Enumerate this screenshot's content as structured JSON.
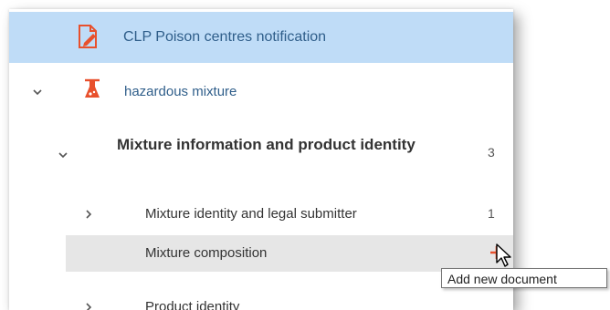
{
  "tree": {
    "notification": {
      "label": "CLP Poison centres notification",
      "icon": "document-edit-icon"
    },
    "mixture": {
      "label": "hazardous mixture",
      "icon": "flask-icon"
    },
    "info_section": {
      "title": "Mixture information and product identity",
      "count": "3"
    },
    "identity": {
      "label": "Mixture identity and legal submitter",
      "count": "1"
    },
    "composition": {
      "label": "Mixture composition",
      "action_icon": "plus-icon"
    },
    "product": {
      "label": "Product identity"
    }
  },
  "tooltip": {
    "text": "Add new document"
  },
  "colors": {
    "selected_row": "#bfdcf7",
    "hover_row": "#e6e6e6",
    "accent": "#e8502c",
    "link_text": "#2f5e8a"
  }
}
